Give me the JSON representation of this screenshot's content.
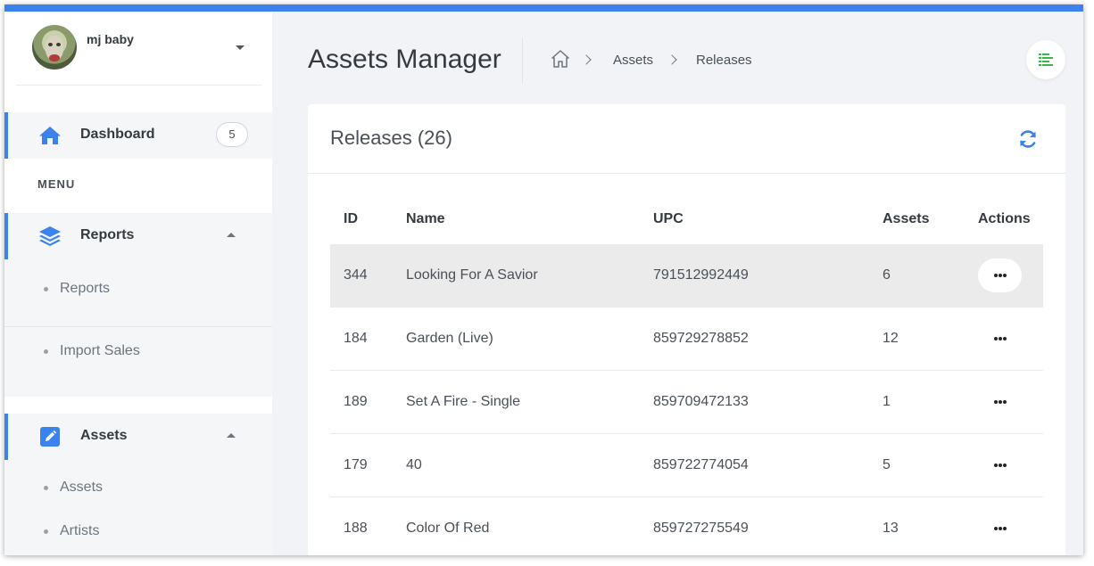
{
  "colors": {
    "accent": "#3b82ec",
    "highlight_row": "#ebebeb",
    "toggle_icon": "#3ab54a"
  },
  "user": {
    "name": "mj baby"
  },
  "sidebar": {
    "dashboard": {
      "label": "Dashboard",
      "badge": "5",
      "icon": "home-icon"
    },
    "menu_heading": "MENU",
    "reports": {
      "label": "Reports",
      "icon": "layers-icon",
      "children": [
        "Reports",
        "Import Sales"
      ]
    },
    "assets": {
      "label": "Assets",
      "icon": "edit-icon",
      "children": [
        "Assets",
        "Artists"
      ]
    }
  },
  "header": {
    "title": "Assets Manager",
    "breadcrumb": [
      "Assets",
      "Releases"
    ]
  },
  "card": {
    "title": "Releases (26)",
    "columns": [
      "ID",
      "Name",
      "UPC",
      "Assets",
      "Actions"
    ],
    "rows": [
      {
        "id": "344",
        "name": "Looking For A Savior",
        "upc": "791512992449",
        "assets": "6"
      },
      {
        "id": "184",
        "name": "Garden (Live)",
        "upc": "859729278852",
        "assets": "12"
      },
      {
        "id": "189",
        "name": "Set A Fire - Single",
        "upc": "859709472133",
        "assets": "1"
      },
      {
        "id": "179",
        "name": "40",
        "upc": "859722774054",
        "assets": "5"
      },
      {
        "id": "188",
        "name": "Color Of Red",
        "upc": "859727275549",
        "assets": "13"
      }
    ]
  }
}
